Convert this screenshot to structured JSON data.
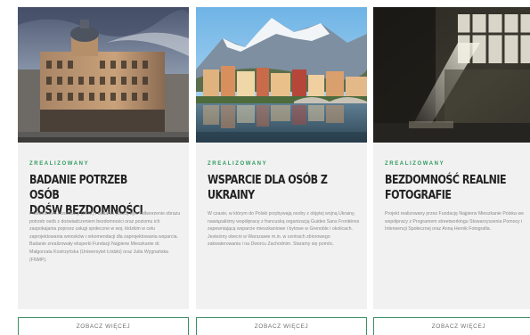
{
  "cards": [
    {
      "status": "ZREALIZOWANY",
      "title": "BADANIE POTRZEB OSÓB\nDOŚW BEZDOMNOŚCI",
      "description": "Przedmiotem konsultacji (2022) i badania (2023) było odtworzenie obrazu potrzeb osób z doświadczeniem bezdomności oraz poziomu ich zaspokajania poprzez usługi społeczne w woj. łódzkim w celu zaprojektowania wniosków i rekomendacji dla zaprojektowania wsparcia. Badanie zrealizowały eksperki Fundacji Najpierw Mieszkanie dr. Małgorzata Kostrzyńska (Uniwersytet Łódzki) oraz Julia Wygnańska (FNMP).",
      "button_label": "ZOBACZ WIĘCEJ"
    },
    {
      "status": "ZREALIZOWANY",
      "title": "WSPARCIE DLA OSÓB Z\nUKRAINY",
      "description": "W czasie, w którym do Polski przybywają osoby z objętej wojną Ukrainy, nawiązaliśmy współpracę z francuską organizacją Guides Sans Frontières zapewniającą wsparcie mieszkaniowe i bytowe w Grenoble i okolicach. Jesteśmy obecni w Warszawie m.in. w centrach zbiorowego zakwaterowania i na Dworcu Zachodnim. Staramy się pomóc.",
      "button_label": "ZOBACZ WIĘCEJ"
    },
    {
      "status": "ZREALIZOWANY",
      "title": "BEZDOMNOŚĆ REALNIE\nFOTOGRAFIE",
      "description": "Projekt realizowany przez Fundację Najpierw Mieszkanie Polska we współpracy z Programem streetworkingu Stowarzyszenia Pomocy i Interwencji Społecznej oraz Anną Hernik Fotografia.",
      "button_label": "ZOBACZ WIĘCEJ"
    }
  ],
  "colors": {
    "accent": "#2e9a5e",
    "panel_bg": "#f1f1f1",
    "title": "#222222",
    "text": "#8a8a8a",
    "button_border": "#3a8f64"
  }
}
